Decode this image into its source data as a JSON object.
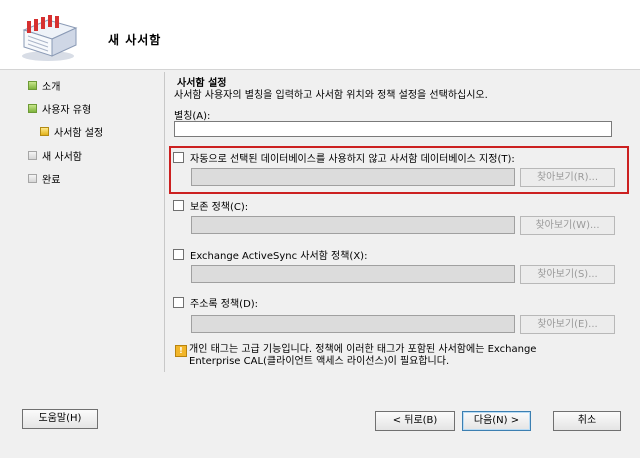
{
  "window": {
    "title": "새 사서함",
    "logo_icon": "mailbox-wizard-icon"
  },
  "nav": {
    "items": [
      {
        "label": "소개",
        "state": "done",
        "color": "#8bc34a"
      },
      {
        "label": "사용자 유형",
        "state": "done",
        "color": "#8bc34a"
      },
      {
        "label": "사서함 설정",
        "state": "current",
        "color": "#e6b422"
      },
      {
        "label": "새 사서함",
        "state": "pending",
        "color": "#d6d6d6"
      },
      {
        "label": "완료",
        "state": "pending",
        "color": "#d6d6d6"
      }
    ]
  },
  "section": {
    "title": "사서함 설정",
    "description": "사서함 사용자의 별칭을 입력하고 사서함 위치와 정책 설정을 선택하십시오."
  },
  "alias": {
    "label": "별칭(A):",
    "value": ""
  },
  "options": [
    {
      "label": "자동으로 선택된 데이터베이스를 사용하지 않고 사서함 데이터베이스 지정(T):",
      "checked": false,
      "browse": "찾아보기(R)...",
      "value": "",
      "highlighted": true
    },
    {
      "label": "보존 정책(C):",
      "checked": false,
      "browse": "찾아보기(W)...",
      "value": ""
    },
    {
      "label": "Exchange ActiveSync 사서함 정책(X):",
      "checked": false,
      "browse": "찾아보기(S)...",
      "value": ""
    },
    {
      "label": "주소록 정책(D):",
      "checked": false,
      "browse": "찾아보기(E)...",
      "value": ""
    }
  ],
  "info": {
    "icon": "info-warning-icon",
    "line1": "개인 태그는 고급 기능입니다. 정책에 이러한 태그가 포함된 사서함에는 Exchange",
    "line2": "Enterprise CAL(클라이언트 액세스 라이선스)이 필요합니다."
  },
  "footer": {
    "help": "도움말(H)",
    "back": "< 뒤로(B)",
    "next": "다음(N) >",
    "cancel": "취소"
  },
  "colors": {
    "highlight_border": "#cc2020",
    "info_icon": "#f2b62a"
  }
}
